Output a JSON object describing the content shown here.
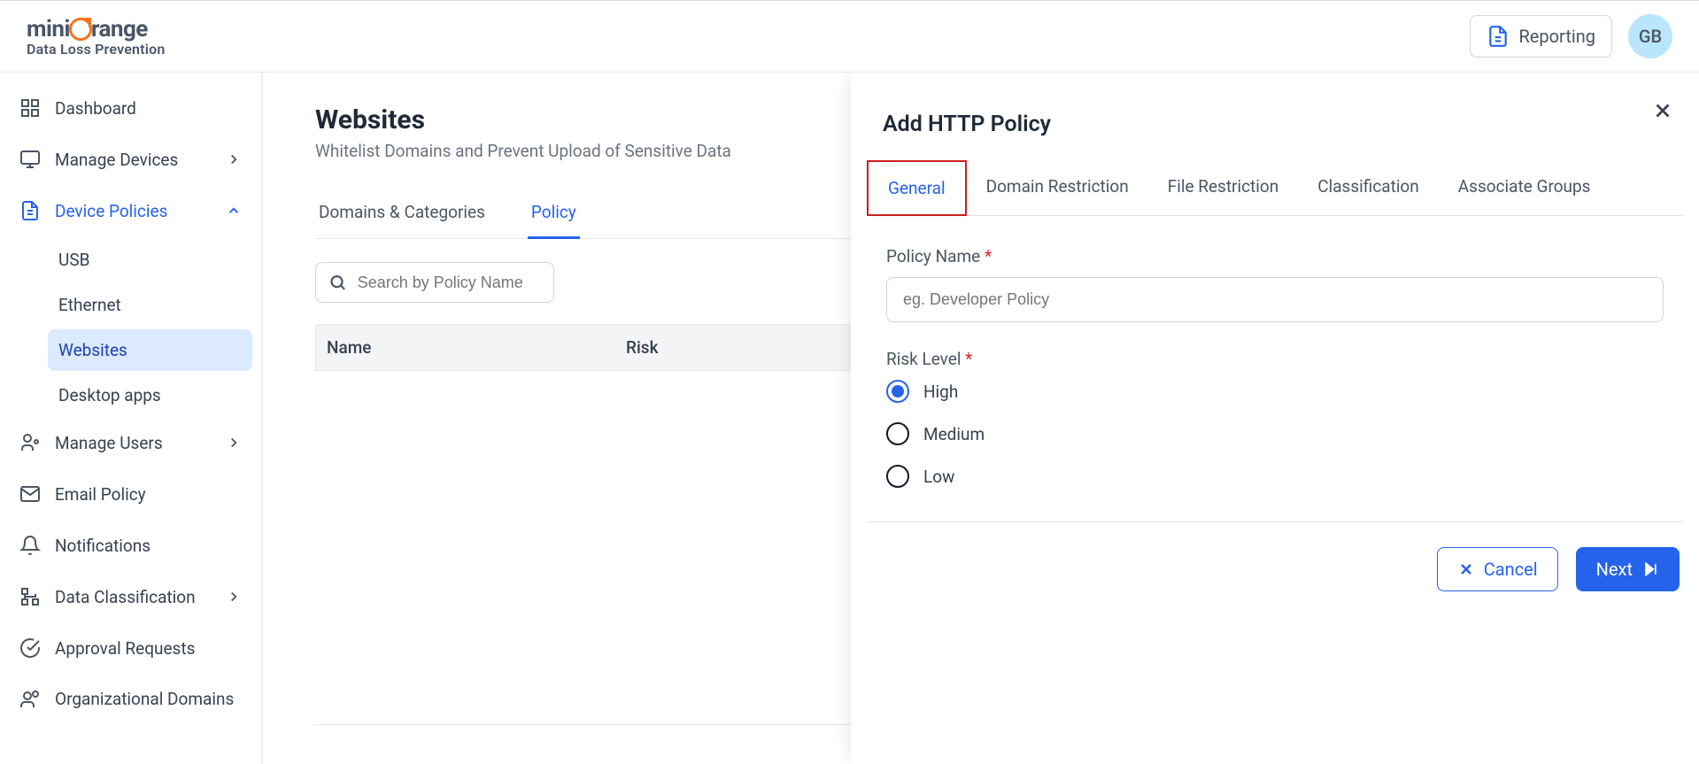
{
  "header": {
    "brand_prefix": "mini",
    "brand_suffix": "range",
    "brand_sub": "Data Loss Prevention",
    "reporting_label": "Reporting",
    "avatar_initials": "GB"
  },
  "sidebar": {
    "items": [
      {
        "label": "Dashboard"
      },
      {
        "label": "Manage Devices"
      },
      {
        "label": "Device Policies"
      },
      {
        "label": "Manage Users"
      },
      {
        "label": "Email Policy"
      },
      {
        "label": "Notifications"
      },
      {
        "label": "Data Classification"
      },
      {
        "label": "Approval Requests"
      },
      {
        "label": "Organizational Domains"
      }
    ],
    "device_policies_sub": [
      {
        "label": "USB"
      },
      {
        "label": "Ethernet"
      },
      {
        "label": "Websites"
      },
      {
        "label": "Desktop apps"
      }
    ]
  },
  "main": {
    "title": "Websites",
    "subtitle": "Whitelist Domains and Prevent Upload of Sensitive Data",
    "tabs": [
      {
        "label": "Domains & Categories"
      },
      {
        "label": "Policy"
      }
    ],
    "search_placeholder": "Search by Policy Name",
    "columns": {
      "name": "Name",
      "risk": "Risk"
    }
  },
  "panel": {
    "title": "Add HTTP Policy",
    "tabs": [
      {
        "label": "General"
      },
      {
        "label": "Domain Restriction"
      },
      {
        "label": "File Restriction"
      },
      {
        "label": "Classification"
      },
      {
        "label": "Associate Groups"
      }
    ],
    "policy_name_label": "Policy Name",
    "policy_name_placeholder": "eg. Developer Policy",
    "risk_label": "Risk Level",
    "risk_options": {
      "high": "High",
      "medium": "Medium",
      "low": "Low"
    },
    "risk_selected": "High",
    "cancel_label": "Cancel",
    "next_label": "Next"
  }
}
